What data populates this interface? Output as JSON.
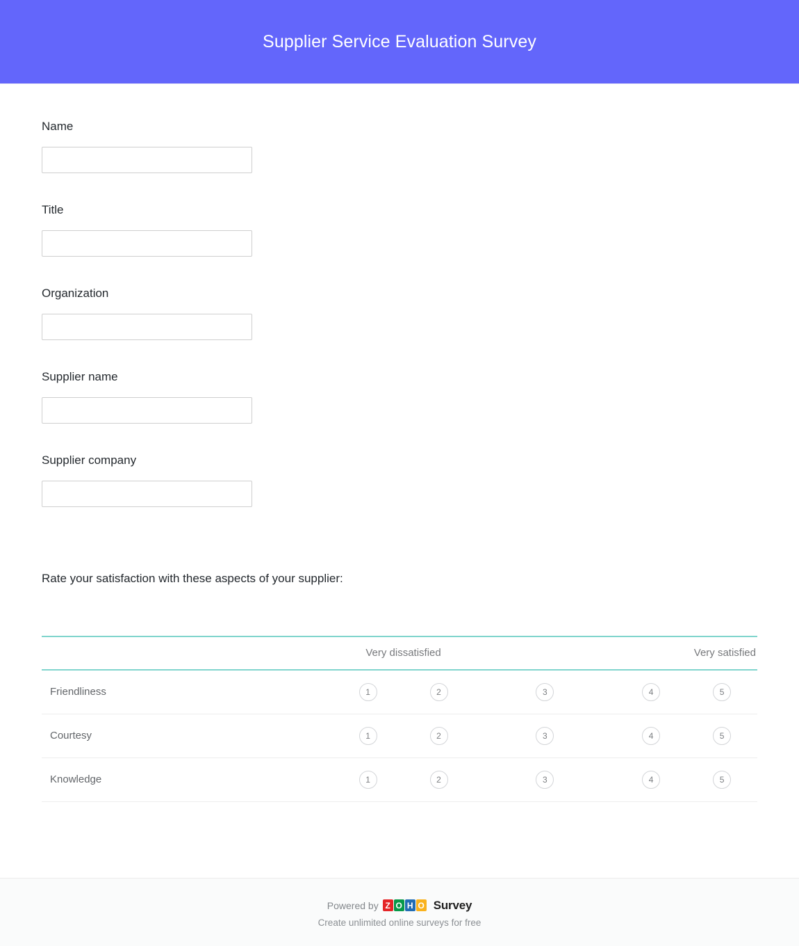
{
  "header": {
    "title": "Supplier Service Evaluation Survey",
    "background_color": "#6366fb",
    "title_color": "#ffffff"
  },
  "form": {
    "fields": [
      {
        "label": "Name",
        "value": "",
        "placeholder": ""
      },
      {
        "label": "Title",
        "value": "",
        "placeholder": ""
      },
      {
        "label": "Organization",
        "value": "",
        "placeholder": ""
      },
      {
        "label": "Supplier name",
        "value": "",
        "placeholder": ""
      },
      {
        "label": "Supplier company",
        "value": "",
        "placeholder": ""
      }
    ]
  },
  "matrix": {
    "question": "Rate your satisfaction with these aspects of your supplier:",
    "anchor_low": "Very dissatisfied",
    "anchor_high": "Very satisfied",
    "scale": [
      "1",
      "2",
      "3",
      "4",
      "5"
    ],
    "rows": [
      {
        "label": "Friendliness",
        "options": [
          "1",
          "2",
          "3",
          "4",
          "5"
        ]
      },
      {
        "label": "Courtesy",
        "options": [
          "1",
          "2",
          "3",
          "4",
          "5"
        ]
      },
      {
        "label": "Knowledge",
        "options": [
          "1",
          "2",
          "3",
          "4",
          "5"
        ]
      }
    ],
    "accent_color": "#80d5cd"
  },
  "footer": {
    "powered_by": "Powered by",
    "brand_tiles": [
      {
        "letter": "Z",
        "color": "#e42527"
      },
      {
        "letter": "O",
        "color": "#089949"
      },
      {
        "letter": "H",
        "color": "#226db4"
      },
      {
        "letter": "O",
        "color": "#f9b21d"
      }
    ],
    "brand_word": "Survey",
    "tagline": "Create unlimited online surveys for free"
  }
}
